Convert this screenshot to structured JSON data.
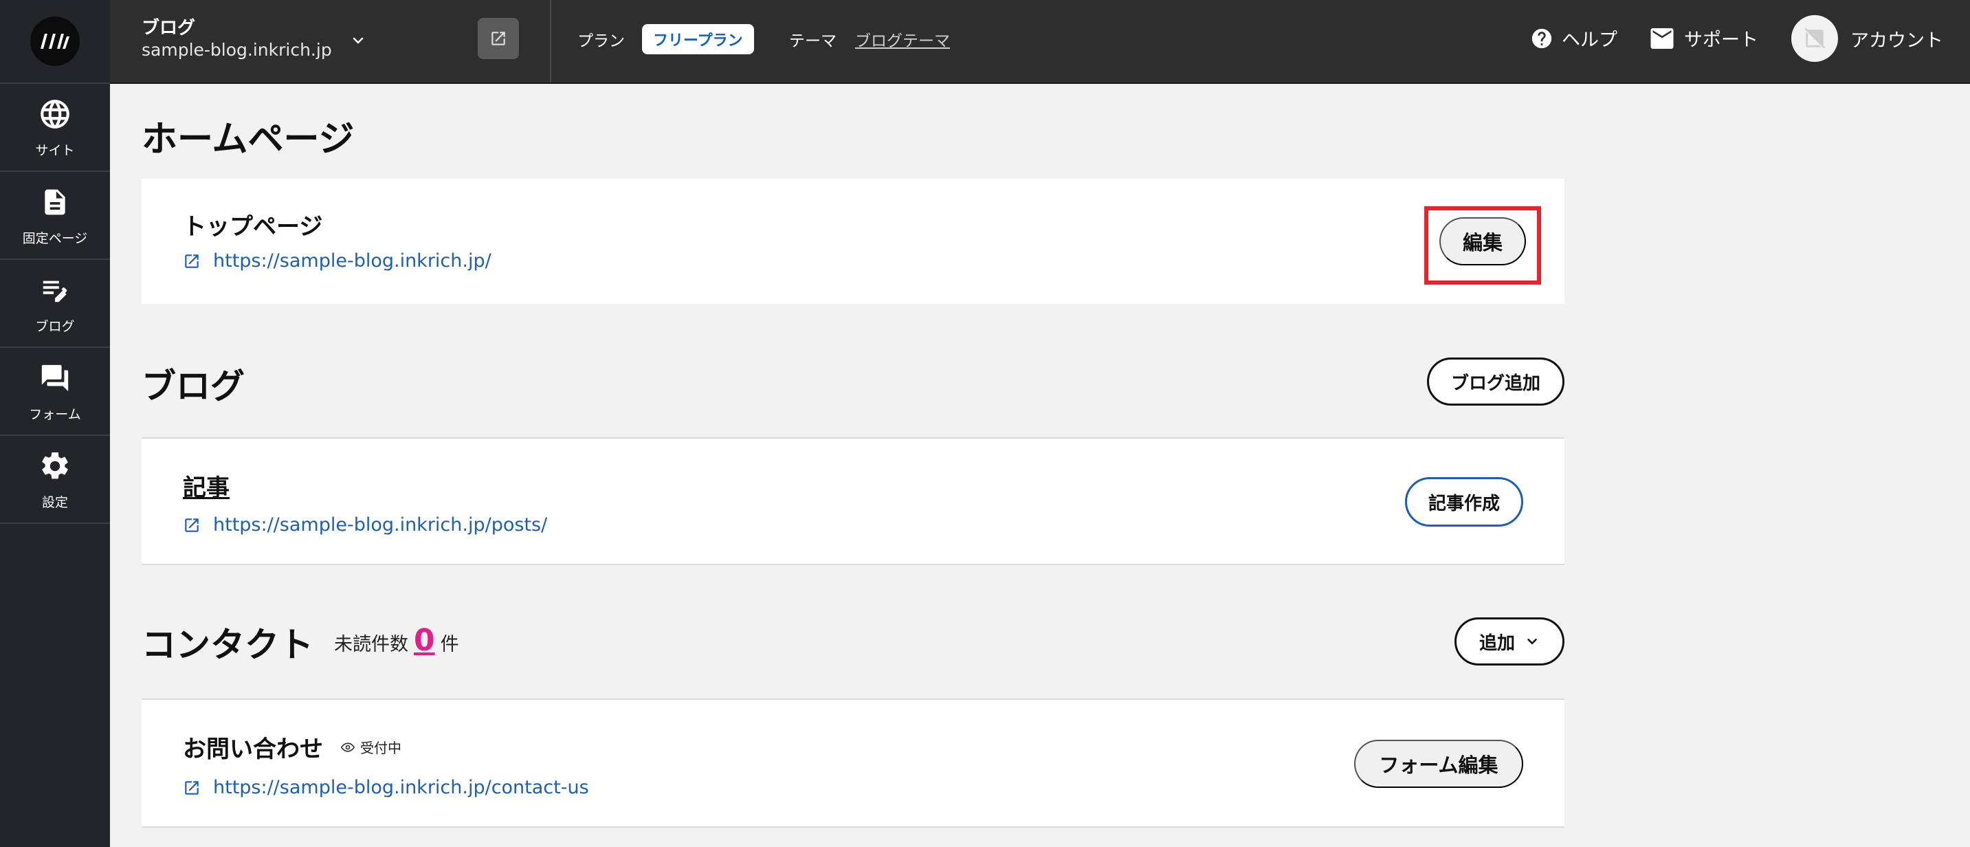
{
  "sidebar": {
    "logo_icon": "inkrich-logo-icon",
    "items": [
      {
        "label": "サイト",
        "icon": "globe-icon"
      },
      {
        "label": "固定ページ",
        "icon": "document-icon"
      },
      {
        "label": "ブログ",
        "icon": "edit-list-icon"
      },
      {
        "label": "フォーム",
        "icon": "forum-icon"
      },
      {
        "label": "設定",
        "icon": "gear-icon"
      }
    ]
  },
  "header": {
    "site_name": "ブログ",
    "site_domain": "sample-blog.inkrich.jp",
    "plan_label": "プラン",
    "plan_value": "フリープラン",
    "theme_label": "テーマ",
    "theme_value": "ブログテーマ",
    "help_label": "ヘルプ",
    "support_label": "サポート",
    "account_label": "アカウント"
  },
  "homepage": {
    "title": "ホームページ",
    "page_name": "トップページ",
    "page_url": "https://sample-blog.inkrich.jp/",
    "edit_label": "編集"
  },
  "blog": {
    "title": "ブログ",
    "add_label": "ブログ追加",
    "item_name": "記事",
    "item_url": "https://sample-blog.inkrich.jp/posts/",
    "create_label": "記事作成"
  },
  "contact": {
    "title": "コンタクト",
    "unread_prefix": "未読件数",
    "unread_count": "0",
    "unread_suffix": "件",
    "add_label": "追加",
    "form_name": "お問い合わせ",
    "form_status": "受付中",
    "form_url": "https://sample-blog.inkrich.jp/contact-us",
    "form_edit_label": "フォーム編集"
  },
  "colors": {
    "sidebar_bg": "#24252a",
    "header_bg": "#2e2e2e",
    "link": "#1a5fb8",
    "unread_accent": "#e0218a",
    "highlight": "#e8232d"
  }
}
